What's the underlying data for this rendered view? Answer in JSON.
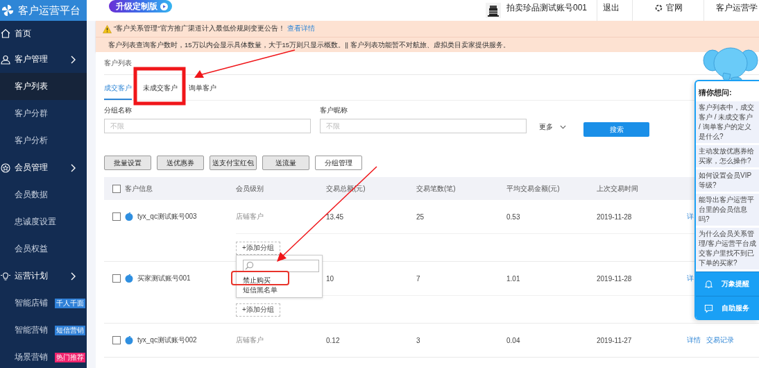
{
  "app": {
    "title": "客户运营平台",
    "upgrade_badge": "升级定制版"
  },
  "top_nav": {
    "account": "拍卖珍品测试账号001",
    "logout": "退出",
    "official_site": "官网",
    "academy": "客户运营学"
  },
  "sidebar": {
    "items": [
      {
        "label": "首页",
        "kind": "section",
        "selected": false
      },
      {
        "label": "客户管理",
        "kind": "group",
        "selected": false
      },
      {
        "label": "客户列表",
        "kind": "page",
        "selected": true
      },
      {
        "label": "客户分群",
        "kind": "page",
        "selected": false
      },
      {
        "label": "客户分析",
        "kind": "page",
        "selected": false
      },
      {
        "label": "会员管理",
        "kind": "group",
        "selected": false
      },
      {
        "label": "会员数据",
        "kind": "page",
        "selected": false
      },
      {
        "label": "忠诚度设置",
        "kind": "page",
        "selected": false
      },
      {
        "label": "会员权益",
        "kind": "page",
        "selected": false
      },
      {
        "label": "运营计划",
        "kind": "group",
        "selected": false
      },
      {
        "label": "智能店铺",
        "kind": "page",
        "selected": false,
        "badge": {
          "text": "千人千面",
          "color": "#2f80d8"
        }
      },
      {
        "label": "智能营销",
        "kind": "page",
        "selected": false,
        "badge": {
          "text": "短信营销",
          "color": "#2f80d8"
        }
      },
      {
        "label": "场景营销",
        "kind": "page",
        "selected": false,
        "badge": {
          "text": "热门推荐",
          "color": "#f0246e"
        }
      }
    ]
  },
  "notice": {
    "headline": "\"客户关系管理\"官方推广渠道计入最低价规则变更公告！",
    "link": "查看详情",
    "detail": "客户列表查询客户数时，15万以内会显示具体数量，大于15万则只显示概数。|| 客户列表功能暂不对航旅、虚拟类目卖家提供服务。"
  },
  "breadcrumb": "客户列表",
  "tabs": [
    {
      "label": "成交客户",
      "selected": true
    },
    {
      "label": "未成交客户",
      "selected": false
    },
    {
      "label": "询单客户",
      "selected": false
    }
  ],
  "filters": [
    {
      "label": "分组名称",
      "placeholder": "不限"
    },
    {
      "label": "客户昵称",
      "placeholder": "不限"
    }
  ],
  "more": "更多",
  "search_button": "搜索",
  "actions": [
    {
      "label": "批量设置",
      "kind": "filled"
    },
    {
      "label": "送优惠券",
      "kind": "filled"
    },
    {
      "label": "送支付宝红包",
      "kind": "filled"
    },
    {
      "label": "送流量",
      "kind": "filled"
    },
    {
      "label": "分组管理",
      "kind": "outline"
    }
  ],
  "table": {
    "all_checked": false,
    "columns": [
      "客户信息",
      "会员级别",
      "交易总额(元)",
      "交易笔数(笔)",
      "平均交易金额(元)",
      "上次交易时间"
    ],
    "rows": [
      {
        "checked": false,
        "name": "tyx_qc测试账号003",
        "level": "店铺客户",
        "total": "13.45",
        "count": "25",
        "average": "0.53",
        "last_trade": "2019-11-28",
        "actions": [
          "详"
        ],
        "add_group": "+添加分组",
        "group_menu": {
          "options": [
            "禁止购买",
            "短信黑名单"
          ]
        }
      },
      {
        "checked": false,
        "name": "买家测试账号001",
        "total": "10",
        "count": "7",
        "average": "1.01",
        "last_trade": "2019-11-28",
        "actions": [
          "详"
        ],
        "add_group": "+添加分组"
      },
      {
        "checked": false,
        "name": "tyx_qc测试账号002",
        "level": "店铺客户",
        "total": "0.12",
        "count": "3",
        "average": "0.04",
        "last_trade": "2019-11-27",
        "actions": [
          "详情",
          "交易记录"
        ]
      }
    ]
  },
  "assistant": {
    "title": "猜你想问:",
    "questions": [
      "客户列表中，成交客户 / 未成交客户 / 询单客户的定义是什么?",
      "主动发放优惠券给买家，怎么操作?",
      "如何设置会员VIP等级?",
      "能导出客户运营平台里的会员信息吗?",
      "为什么会员关系管理/客户运营平台成交客户里找不到已下单的买家?"
    ],
    "buttons": [
      {
        "label": "万象提醒",
        "kind": "bell"
      },
      {
        "label": "自助服务",
        "kind": "chat"
      }
    ]
  }
}
